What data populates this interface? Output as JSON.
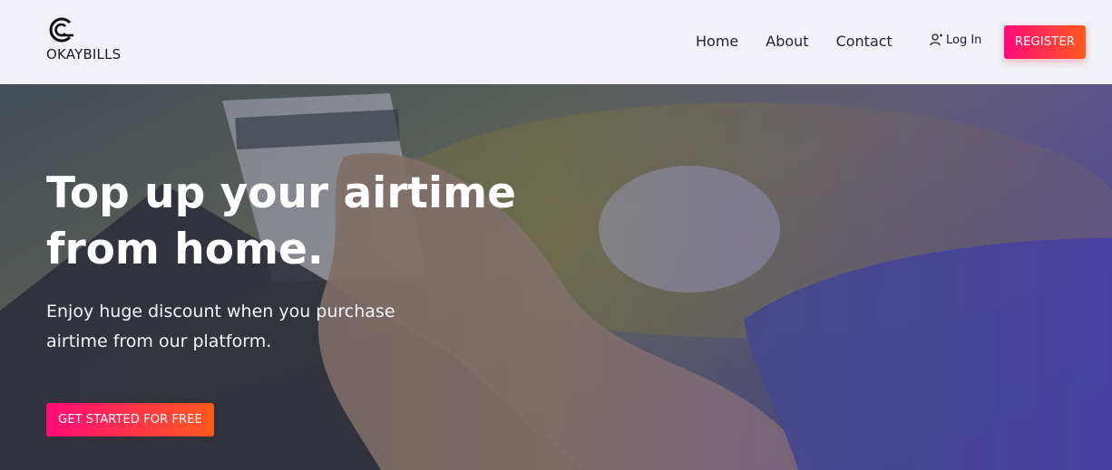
{
  "brand": {
    "name": "OKAYBILLS",
    "logo_icon": "brand-logo-icon"
  },
  "nav": {
    "links": [
      {
        "label": "Home"
      },
      {
        "label": "About"
      },
      {
        "label": "Contact"
      }
    ],
    "login_label": "Log In",
    "login_icon": "user-icon",
    "register_label": "REGISTER"
  },
  "hero": {
    "title": "Top up your airtime from home.",
    "subtitle": "Enjoy huge discount when you purchase airtime from our platform.",
    "cta_label": "GET STARTED FOR FREE"
  },
  "colors": {
    "accent_start": "#ff0a78",
    "accent_end": "#ff5a1e",
    "navbar_bg": "#f1f1f7",
    "text_dark": "#25253a"
  }
}
